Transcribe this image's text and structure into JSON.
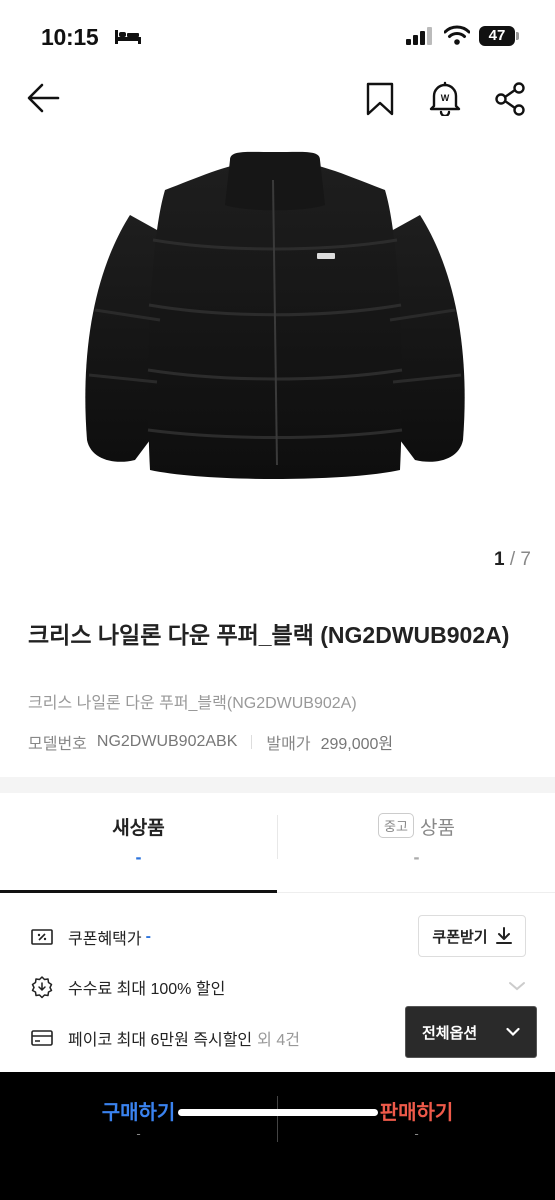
{
  "status_bar": {
    "time": "10:15",
    "battery": "47"
  },
  "header": {
    "back_icon": "arrow-left-icon",
    "bookmark_icon": "bookmark-icon",
    "alarm_icon": "price-alarm-icon",
    "share_icon": "share-icon"
  },
  "gallery": {
    "current": "1",
    "separator": "/",
    "total": "7"
  },
  "product": {
    "title": "크리스 나일론 다운 푸퍼_블랙 (NG2DWUB902A)",
    "subtitle": "크리스 나일론 다운 푸퍼_블랙(NG2DWUB902A)",
    "model_label": "모델번호",
    "model_value": "NG2DWUB902ABK",
    "release_label": "발매가",
    "release_value": "299,000원"
  },
  "tabs": {
    "new": {
      "label": "새상품",
      "value": "-"
    },
    "used": {
      "chip": "중고",
      "label": "상품",
      "value": "-"
    }
  },
  "benefits": {
    "coupon_label": "쿠폰혜택가",
    "coupon_value": "-",
    "coupon_button": "쿠폰받기",
    "fee_label": "수수료 최대 100% 할인",
    "pay_label": "페이코 최대 6만원 즉시할인",
    "pay_extra": "외 4건",
    "all_options": "전체옵션"
  },
  "bottom_bar": {
    "buy_label": "구매하기",
    "buy_price": "-",
    "sell_label": "판매하기",
    "sell_price": "-"
  },
  "colors": {
    "accent_blue": "#2d74dc",
    "buy_blue": "#3a82ee",
    "sell_red": "#ef5a4a"
  }
}
